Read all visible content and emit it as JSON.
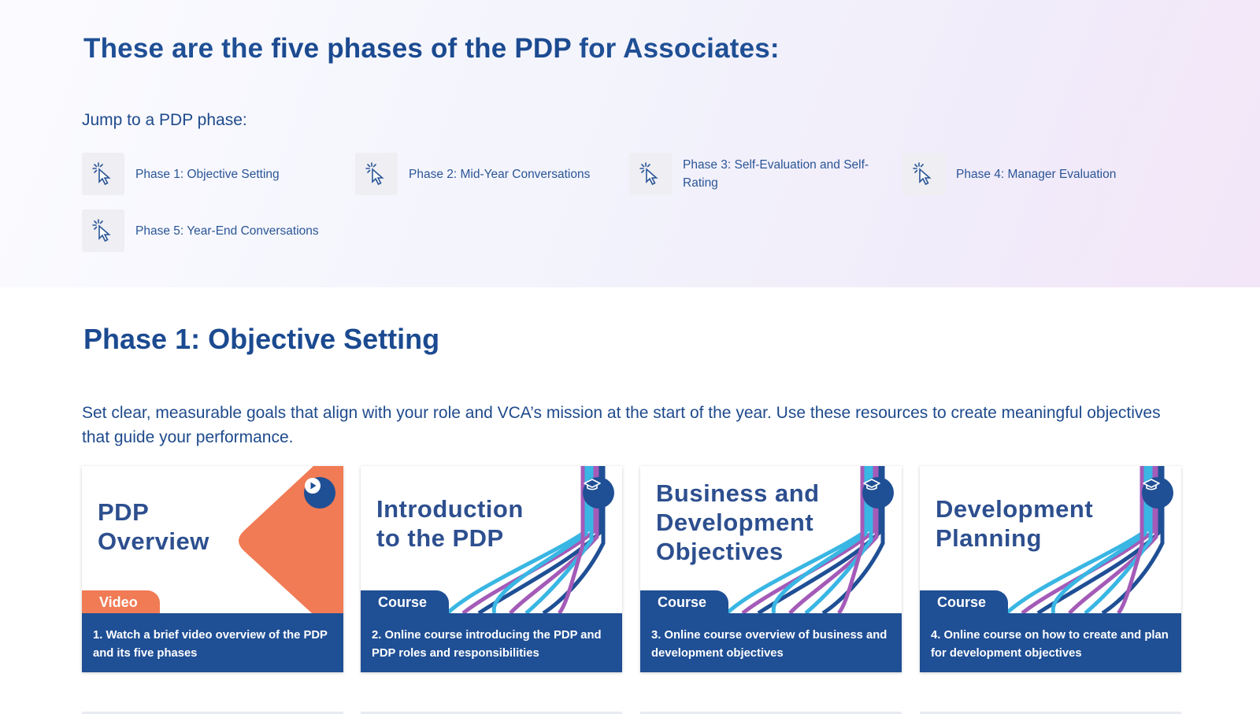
{
  "hero": {
    "title_before": "These are the ",
    "title_bold": "five phases of the PDP",
    "title_after": " for Associates:",
    "jump_label": "Jump to a PDP phase:",
    "phase_links": [
      {
        "label": "Phase 1: Objective Setting"
      },
      {
        "label": "Phase 2: Mid-Year Conversations"
      },
      {
        "label": "Phase 3: Self-Evaluation and Self-Rating"
      },
      {
        "label": "Phase 4: Manager Evaluation"
      },
      {
        "label": "Phase 5: Year-End Conversations"
      }
    ]
  },
  "section": {
    "title": "Phase 1: Objective Setting",
    "description": "Set clear, measurable goals that align with your role and VCA’s mission at the start of the year. Use these resources to create meaningful objectives that guide your performance."
  },
  "cards": [
    {
      "heading_line1": "PDP",
      "heading_line2": "Overview",
      "heading_line3": "",
      "tag": "Video",
      "badge_icon": "play-icon",
      "caption": "1. Watch a brief video overview of the PDP and its five phases"
    },
    {
      "heading_line1": "Introduction",
      "heading_line2": "to the PDP",
      "heading_line3": "",
      "tag": "Course",
      "badge_icon": "graduation-cap-icon",
      "caption": "2. Online course introducing the PDP and PDP roles and responsibilities"
    },
    {
      "heading_line1": "Business and",
      "heading_line2": "Development",
      "heading_line3": "Objectives",
      "tag": "Course",
      "badge_icon": "graduation-cap-icon",
      "caption": "3. Online course overview of business and development objectives"
    },
    {
      "heading_line1": "Development",
      "heading_line2": "Planning",
      "heading_line3": "",
      "tag": "Course",
      "badge_icon": "graduation-cap-icon",
      "caption": "4. Online course on how to create and plan for development objectives"
    }
  ],
  "colors": {
    "brand_blue": "#1f4f95",
    "video_orange": "#f07b55",
    "stripe_purple": "#a45bb8",
    "stripe_cyan": "#39b6e3"
  }
}
